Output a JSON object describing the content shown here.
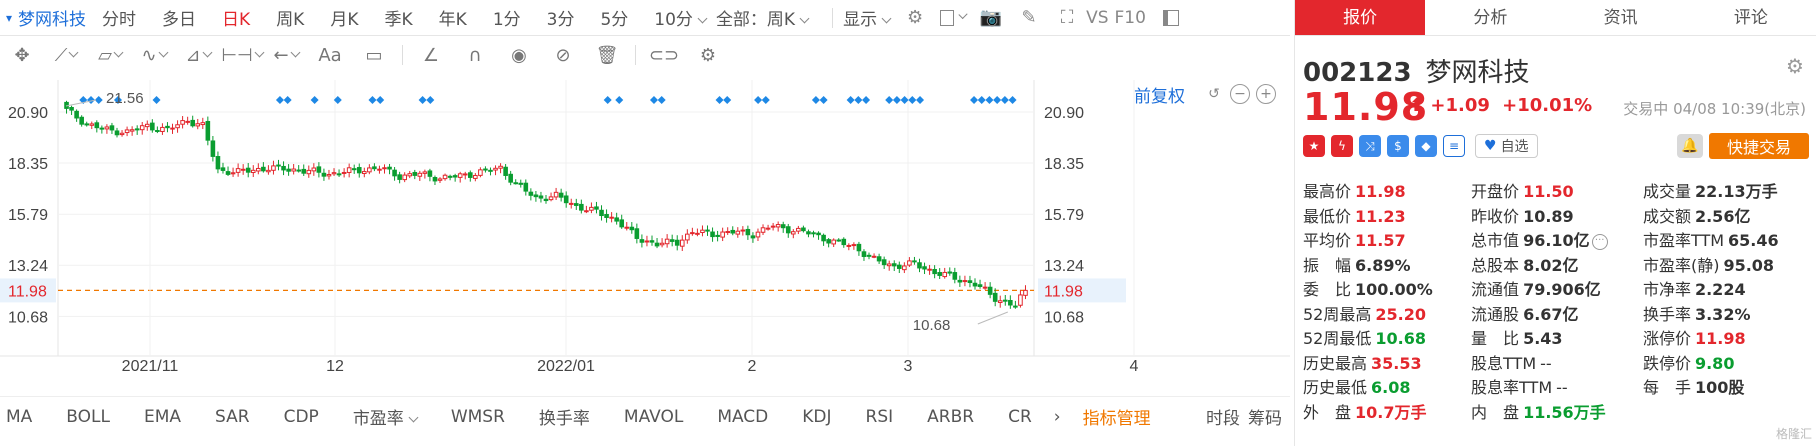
{
  "toolbar": {
    "stock_name": "梦网科技",
    "periods": [
      "分时",
      "多日",
      "日K",
      "周K",
      "月K",
      "季K",
      "年K",
      "1分",
      "3分",
      "5分",
      "10分"
    ],
    "active_period": "日K",
    "range_select": "全部：周K",
    "display_label": "显示",
    "vs_label": "VS",
    "f10_label": "F10"
  },
  "drawtools": {
    "text_tool": "Aa"
  },
  "chart": {
    "fuquan_label": "前复权",
    "y_ticks": [
      "20.90",
      "18.35",
      "15.79",
      "13.24",
      "11.98",
      "10.68"
    ],
    "current_price_marker": "11.98",
    "x_ticks": [
      "2021/11",
      "12",
      "2022/01",
      "2",
      "3",
      "4"
    ],
    "high_annotation": "21.56",
    "low_annotation": "10.68"
  },
  "chart_data": {
    "type": "candlestick",
    "current_price": 11.98,
    "high_marker": 21.56,
    "low_marker": 10.68,
    "y_ticks": [
      20.9,
      18.35,
      15.79,
      13.24,
      11.98,
      10.68
    ],
    "x_ticks": [
      "2021/11",
      "12",
      "2022/01",
      "2",
      "3",
      "4"
    ],
    "ylim": [
      9.7,
      22.0
    ],
    "colors": {
      "up": "#e3272d",
      "down": "#0a9d30",
      "marker": "#1e88e5",
      "price_line": "#f07800"
    }
  },
  "indicators": {
    "items": [
      "MA",
      "BOLL",
      "EMA",
      "SAR",
      "CDP",
      "市盈率",
      "WMSR",
      "换手率",
      "MAVOL",
      "MACD",
      "KDJ",
      "RSI",
      "ARBR",
      "CR"
    ],
    "manage_label": "指标管理",
    "right_items": [
      "时段",
      "筹码"
    ]
  },
  "panel": {
    "tabs": [
      "报价",
      "分析",
      "资讯",
      "评论"
    ],
    "active_tab": "报价",
    "code": "002123",
    "name": "梦网科技",
    "price": "11.98",
    "change": "+1.09",
    "change_pct": "+10.01%",
    "trade_time": "交易中 04/08 10:39(北京)",
    "watch_label": "自选",
    "quick_trade_label": "快捷交易",
    "stats": [
      [
        {
          "label": "最高价",
          "value": "11.98",
          "color": "red"
        },
        {
          "label": "开盘价",
          "value": "11.50",
          "color": "red"
        },
        {
          "label": "成交量",
          "value": "22.13万手",
          "color": "dark"
        }
      ],
      [
        {
          "label": "最低价",
          "value": "11.23",
          "color": "red"
        },
        {
          "label": "昨收价",
          "value": "10.89",
          "color": "dark"
        },
        {
          "label": "成交额",
          "value": "2.56亿",
          "color": "dark"
        }
      ],
      [
        {
          "label": "平均价",
          "value": "11.57",
          "color": "red"
        },
        {
          "label": "总市值",
          "value": "96.10亿",
          "color": "dark"
        },
        {
          "label": "市盈率TTM",
          "value": "65.46",
          "color": "dark"
        }
      ],
      [
        {
          "label": "振　幅",
          "value": "6.89%",
          "color": "dark"
        },
        {
          "label": "总股本",
          "value": "8.02亿",
          "color": "dark"
        },
        {
          "label": "市盈率(静)",
          "value": "95.08",
          "color": "dark"
        }
      ],
      [
        {
          "label": "委　比",
          "value": "100.00%",
          "color": "dark"
        },
        {
          "label": "流通值",
          "value": "79.906亿",
          "color": "dark"
        },
        {
          "label": "市净率",
          "value": "2.224",
          "color": "dark"
        }
      ],
      [
        {
          "label": "52周最高",
          "value": "25.20",
          "color": "red"
        },
        {
          "label": "流通股",
          "value": "6.67亿",
          "color": "dark"
        },
        {
          "label": "换手率",
          "value": "3.32%",
          "color": "dark"
        }
      ],
      [
        {
          "label": "52周最低",
          "value": "10.68",
          "color": "green"
        },
        {
          "label": "量　比",
          "value": "5.43",
          "color": "dark"
        },
        {
          "label": "涨停价",
          "value": "11.98",
          "color": "red"
        }
      ],
      [
        {
          "label": "历史最高",
          "value": "35.53",
          "color": "red"
        },
        {
          "label": "股息TTM",
          "value": "--",
          "color": "dark"
        },
        {
          "label": "跌停价",
          "value": "9.80",
          "color": "green"
        }
      ],
      [
        {
          "label": "历史最低",
          "value": "6.08",
          "color": "green"
        },
        {
          "label": "股息率TTM",
          "value": "--",
          "color": "dark"
        },
        {
          "label": "每　手",
          "value": "100股",
          "color": "dark"
        }
      ],
      [
        {
          "label": "外　盘",
          "value": "10.7万手",
          "color": "red"
        },
        {
          "label": "内　盘",
          "value": "11.56万手",
          "color": "green"
        },
        {
          "label": "",
          "value": "",
          "color": "dark"
        }
      ]
    ]
  }
}
